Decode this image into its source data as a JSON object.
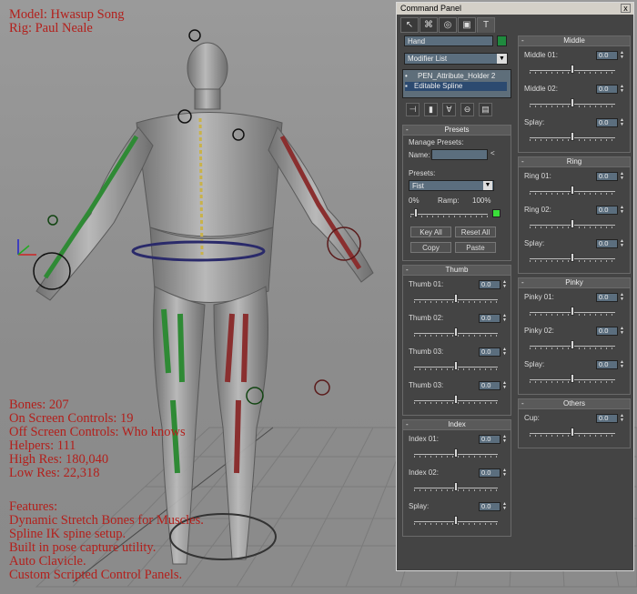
{
  "overlay": {
    "top": [
      "Model: Hwasup Song",
      "Rig: Paul Neale"
    ],
    "stats": [
      "Bones: 207",
      "On Screen Controls: 19",
      "Off Screen Controls: Who knows",
      "Helpers: 111",
      "High Res: 180,040",
      "Low Res: 22,318"
    ],
    "features": [
      "Features:",
      "Dynamic Stretch Bones for Muscles.",
      "Spline IK spine setup.",
      "Built in pose capture utility.",
      "Auto Clavicle.",
      "Custom Scripted Control Panels."
    ]
  },
  "colors": {
    "overlay_text": "#b3201c",
    "panel_bg": "#444444",
    "field_bg": "#5b6e7e",
    "swatch_green": "#1f8a3e",
    "left_arm_rig": "#2f8a35",
    "right_arm_rig": "#8a2f2f",
    "ring": "#2a2a6a"
  },
  "command_panel": {
    "title": "Command Panel",
    "close": "x",
    "tabs": [
      {
        "icon": "create-icon",
        "glyph": "↖"
      },
      {
        "icon": "hierarchy-icon",
        "glyph": "⌘"
      },
      {
        "icon": "motion-icon",
        "glyph": "◎"
      },
      {
        "icon": "display-icon",
        "glyph": "▣"
      },
      {
        "icon": "utilities-icon",
        "glyph": "T"
      }
    ],
    "object_name": "Hand",
    "modifier_list": "Modifier List",
    "stack": [
      "PEN_Attribute_Holder 2",
      "Editable Spline"
    ],
    "stack_tools": [
      "pin-stack-icon",
      "show-end-result-icon",
      "make-unique-icon",
      "remove-modifier-icon",
      "configure-sets-icon"
    ],
    "stack_glyphs": [
      "⊣",
      "▮",
      "∀",
      "⊖",
      "▤"
    ],
    "presets": {
      "title": "Presets",
      "manage": "Manage Presets:",
      "name_label": "Name:",
      "name_value": "",
      "presets_label": "Presets:",
      "selected": "Fist",
      "pct_start": "0%",
      "ramp": "Ramp:",
      "pct_end": "100%",
      "ramp_value": 0.05,
      "buttons": [
        "Key All",
        "Reset All",
        "Copy",
        "Paste"
      ]
    },
    "left_groups": [
      {
        "title": "Thumb",
        "rows": [
          {
            "label": "Thumb 01:",
            "value": "0.0",
            "pos": 0.5
          },
          {
            "label": "Thumb 02:",
            "value": "0.0",
            "pos": 0.5
          },
          {
            "label": "Thumb 03:",
            "value": "0.0",
            "pos": 0.5
          },
          {
            "label": "Thumb 03:",
            "value": "0.0",
            "pos": 0.5
          }
        ]
      },
      {
        "title": "Index",
        "rows": [
          {
            "label": "Index 01:",
            "value": "0.0",
            "pos": 0.5
          },
          {
            "label": "Index 02:",
            "value": "0.0",
            "pos": 0.5
          },
          {
            "label": "Splay:",
            "value": "0.0",
            "pos": 0.5
          }
        ]
      }
    ],
    "right_groups": [
      {
        "title": "Middle",
        "rows": [
          {
            "label": "Middle 01:",
            "value": "0.0",
            "pos": 0.5
          },
          {
            "label": "Middle 02:",
            "value": "0.0",
            "pos": 0.5
          },
          {
            "label": "Splay:",
            "value": "0.0",
            "pos": 0.5
          }
        ]
      },
      {
        "title": "Ring",
        "rows": [
          {
            "label": "Ring 01:",
            "value": "0.0",
            "pos": 0.5
          },
          {
            "label": "Ring 02:",
            "value": "0.0",
            "pos": 0.5
          },
          {
            "label": "Splay:",
            "value": "0.0",
            "pos": 0.5
          }
        ]
      },
      {
        "title": "Pinky",
        "rows": [
          {
            "label": "Pinky 01:",
            "value": "0.0",
            "pos": 0.5
          },
          {
            "label": "Pinky 02:",
            "value": "0.0",
            "pos": 0.5
          },
          {
            "label": "Splay:",
            "value": "0.0",
            "pos": 0.5
          }
        ]
      },
      {
        "title": "Others",
        "rows": [
          {
            "label": "Cup:",
            "value": "0.0",
            "pos": 0.5
          }
        ]
      }
    ]
  }
}
